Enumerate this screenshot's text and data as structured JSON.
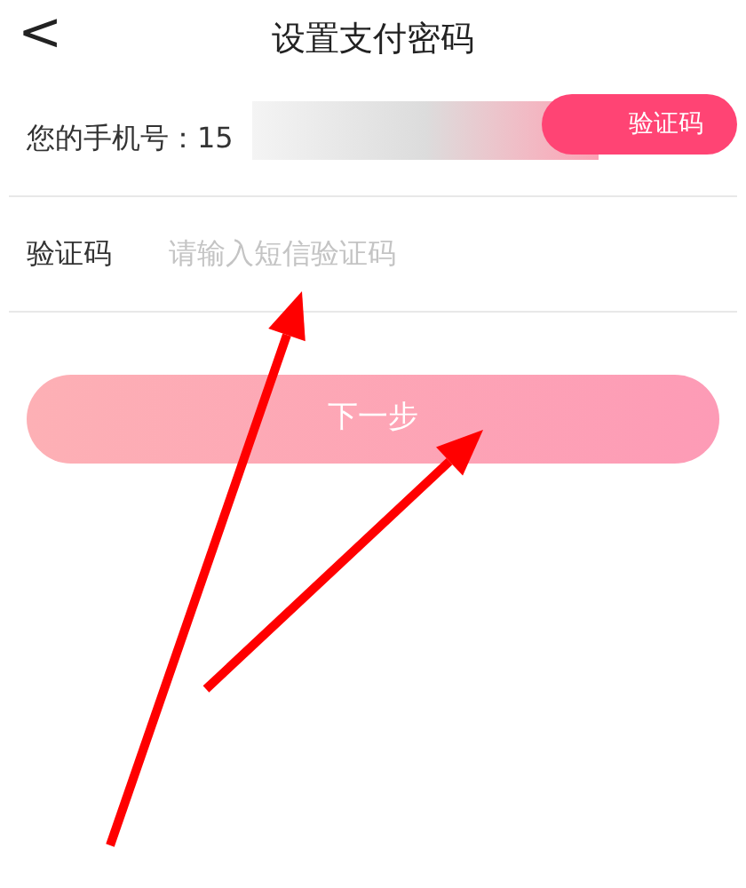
{
  "header": {
    "back": "<",
    "title": "设置支付密码"
  },
  "phone_row": {
    "label": "您的手机号：",
    "value": "15",
    "button": "验证码"
  },
  "code_row": {
    "label": "验证码",
    "placeholder": "请输入短信验证码"
  },
  "next_button": {
    "label": "下一步",
    "disabled": true
  },
  "annotations": [
    {
      "kind": "arrow"
    },
    {
      "kind": "arrow"
    }
  ]
}
